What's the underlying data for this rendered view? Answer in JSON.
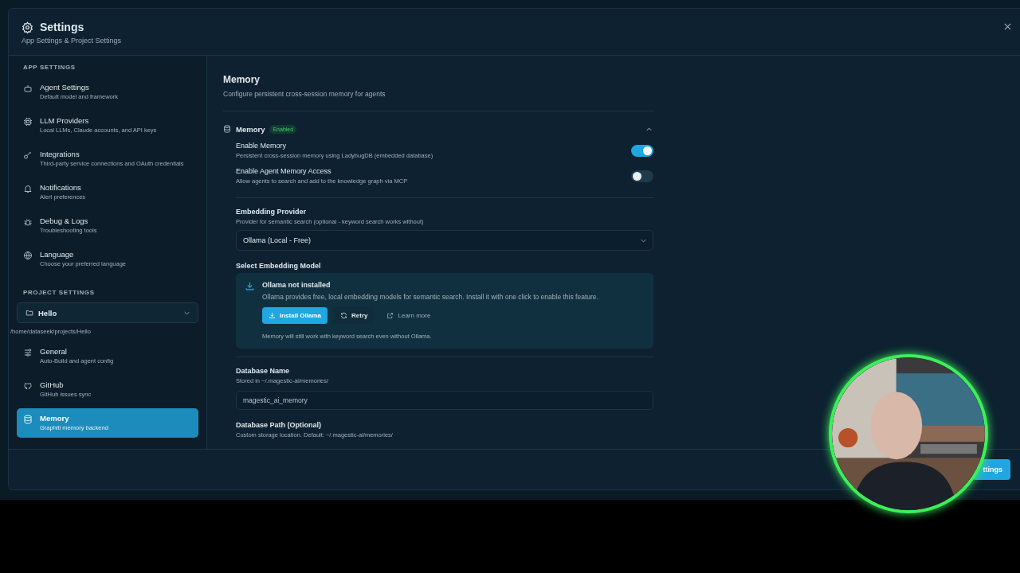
{
  "dialog": {
    "title": "Settings",
    "subtitle": "App Settings & Project Settings"
  },
  "sidebar": {
    "app_settings": {
      "heading": "APP SETTINGS",
      "items": [
        {
          "label": "Agent Settings",
          "description": "Default model and framework",
          "selected": false
        },
        {
          "label": "LLM Providers",
          "description": "Local LLMs, Claude accounts, and API keys",
          "selected": false
        },
        {
          "label": "Integrations",
          "description": "Third-party service connections and OAuth credentials",
          "selected": false
        },
        {
          "label": "Notifications",
          "description": "Alert preferences",
          "selected": false
        },
        {
          "label": "Debug & Logs",
          "description": "Troubleshooting tools",
          "selected": false
        },
        {
          "label": "Language",
          "description": "Choose your preferred language",
          "selected": false
        }
      ]
    },
    "project_settings": {
      "heading": "PROJECT SETTINGS",
      "project": "Hello",
      "path": "/home/dataseek/projects/Hello",
      "items": [
        {
          "label": "General",
          "description": "Auto-Build and agent config",
          "selected": false
        },
        {
          "label": "GitHub",
          "description": "GitHub issues sync",
          "selected": false
        },
        {
          "label": "Memory",
          "description": "Graphiti memory backend",
          "selected": true
        }
      ]
    }
  },
  "content": {
    "title": "Memory",
    "description": "Configure persistent cross-session memory for agents",
    "section": {
      "title": "Memory",
      "badge": "Enabled",
      "expanded": true,
      "toggles": [
        {
          "label": "Enable Memory",
          "description": "Persistent cross-session memory using LadybugDB (embedded database)",
          "on": true
        },
        {
          "label": "Enable Agent Memory Access",
          "description": "Allow agents to search and add to the knowledge graph via MCP",
          "on": false
        }
      ],
      "embedding_provider": {
        "label": "Embedding Provider",
        "description": "Provider for semantic search (optional - keyword search works without)",
        "value": "Ollama (Local - Free)"
      },
      "embedding_model": {
        "label": "Select Embedding Model",
        "notice": {
          "title": "Ollama not installed",
          "text": "Ollama provides free, local embedding models for semantic search. Install it with one click to enable this feature.",
          "buttons": [
            {
              "kind": "primary",
              "label": "Install Ollama"
            },
            {
              "kind": "retry",
              "label": "Retry"
            },
            {
              "kind": "link",
              "label": "Learn more"
            }
          ],
          "footnote": "Memory will still work with keyword search even without Ollama."
        }
      },
      "database_name": {
        "label": "Database Name",
        "description": "Stored in ~/.magestic-ai/memories/",
        "value": "magestic_ai_memory"
      },
      "database_path": {
        "label": "Database Path (Optional)",
        "description": "Custom storage location. Default: ~/.magestic-ai/memories/"
      }
    }
  },
  "footer": {
    "save_button": "ttings"
  }
}
